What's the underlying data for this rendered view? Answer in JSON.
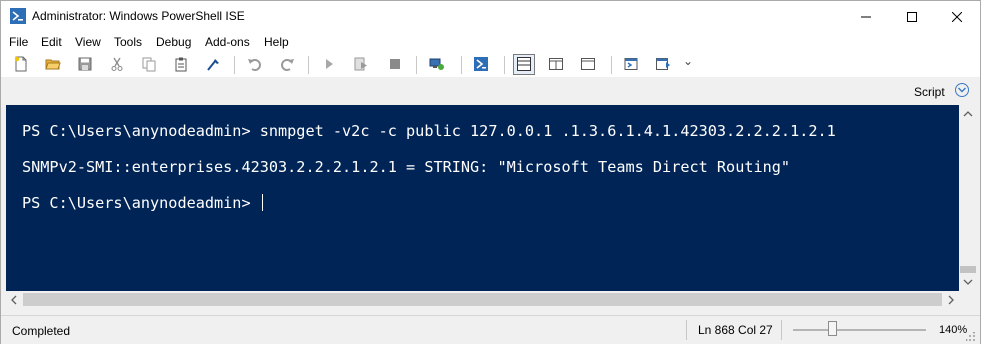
{
  "window": {
    "title": "Administrator: Windows PowerShell ISE"
  },
  "menu": {
    "items": [
      "File",
      "Edit",
      "View",
      "Tools",
      "Debug",
      "Add-ons",
      "Help"
    ]
  },
  "toolbar": {
    "icons": [
      "new-file-icon",
      "open-folder-icon",
      "save-icon",
      "cut-icon",
      "copy-icon",
      "paste-icon",
      "clear-console-icon",
      "undo-icon",
      "redo-icon",
      "run-script-icon",
      "run-selection-icon",
      "stop-icon",
      "new-remote-tab-icon",
      "start-powershell-icon",
      "show-script-top-icon",
      "show-script-right-icon",
      "show-script-maximized-icon",
      "show-command-window-icon",
      "show-command-addon-icon"
    ],
    "overflow": "⌄"
  },
  "scriptbar": {
    "label": "Script"
  },
  "console": {
    "lines": [
      "PS C:\\Users\\anynodeadmin> snmpget -v2c -c public 127.0.0.1 .1.3.6.1.4.1.42303.2.2.2.1.2.1",
      "SNMPv2-SMI::enterprises.42303.2.2.2.1.2.1 = STRING: \"Microsoft Teams Direct Routing\"",
      "PS C:\\Users\\anynodeadmin> "
    ],
    "background": "#012456",
    "foreground": "#ffffff"
  },
  "status": {
    "text": "Completed",
    "position": "Ln 868  Col 27",
    "zoom": "140%",
    "zoom_fraction": 0.3
  }
}
